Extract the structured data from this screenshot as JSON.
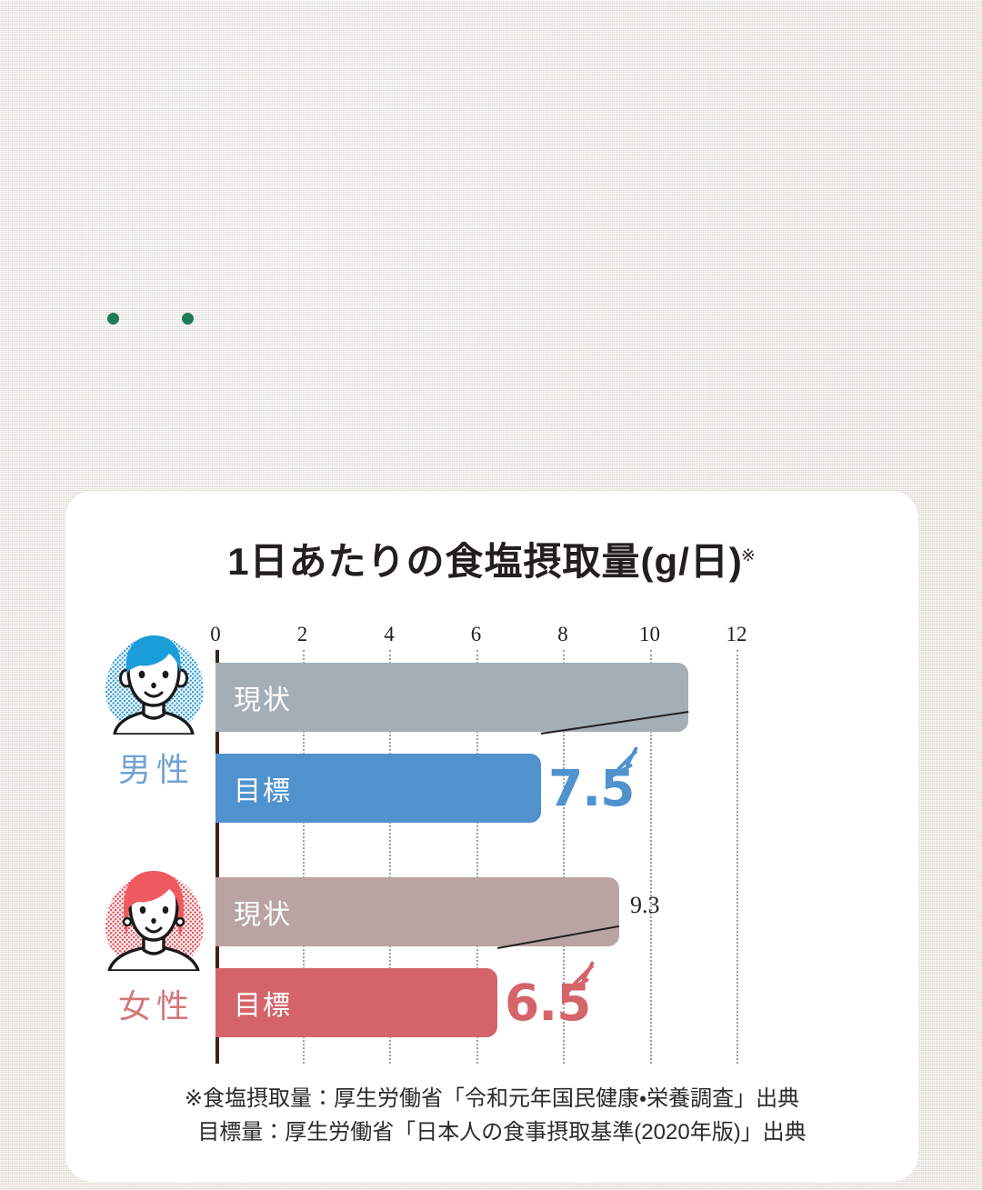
{
  "background": {
    "color": "#ebe9e4",
    "decorations": {
      "dot_color": "#1f7a56",
      "dots": [
        "decor-dot-1",
        "decor-dot-2"
      ]
    }
  },
  "card": {
    "background": "#ffffff",
    "title": "1日あたりの食塩摂取量(g/日)",
    "title_superscript": "※"
  },
  "chart_data": {
    "type": "bar",
    "orientation": "horizontal",
    "title": "1日あたりの食塩摂取量(g/日)",
    "xlabel": "",
    "ylabel": "",
    "xlim": [
      0,
      12.8
    ],
    "xticks": [
      0,
      2,
      4,
      6,
      8,
      10,
      12
    ],
    "xtick_labels": [
      "0",
      "2",
      "4",
      "6",
      "8",
      "10",
      "12"
    ],
    "grid": true,
    "legend": "none",
    "groups": [
      {
        "name": "男性",
        "label": "男性",
        "color": "#6fa3d4",
        "avatar": "male-avatar-icon",
        "bars": [
          {
            "label": "現状",
            "value": 10.9,
            "value_text": "",
            "color": "#a4aeb7",
            "value_label_shown": false
          },
          {
            "label": "目標",
            "value": 7.5,
            "value_text": "7.5",
            "color": "#4f92ce",
            "value_label_shown": true
          }
        ]
      },
      {
        "name": "女性",
        "label": "女性",
        "color": "#d4767a",
        "avatar": "female-avatar-icon",
        "bars": [
          {
            "label": "現状",
            "value": 9.3,
            "value_text": "9.3",
            "color": "#b9a3a3",
            "value_label_shown": true
          },
          {
            "label": "目標",
            "value": 6.5,
            "value_text": "6.5",
            "color": "#d4646a",
            "value_label_shown": true
          }
        ]
      }
    ],
    "axis_line_color": "#3b2417",
    "gridline_color": "#9e9e9e"
  },
  "ticks": {
    "t0": "0",
    "t2": "2",
    "t4": "4",
    "t6": "6",
    "t8": "8",
    "t10": "10",
    "t12": "12"
  },
  "male": {
    "gender_label": "男性",
    "current_label": "現状",
    "target_label": "目標",
    "current_value_text": "",
    "target_value_text": "7.5"
  },
  "female": {
    "gender_label": "女性",
    "current_label": "現状",
    "target_label": "目標",
    "current_value_text": "9.3",
    "target_value_text": "6.5"
  },
  "footnotes": {
    "line1": "※食塩摂取量：厚生労働省「令和元年国民健康・栄養調査」出典",
    "line2": "目標量：厚生労働省「日本人の食事摂取基準(2020年版)」出典"
  }
}
